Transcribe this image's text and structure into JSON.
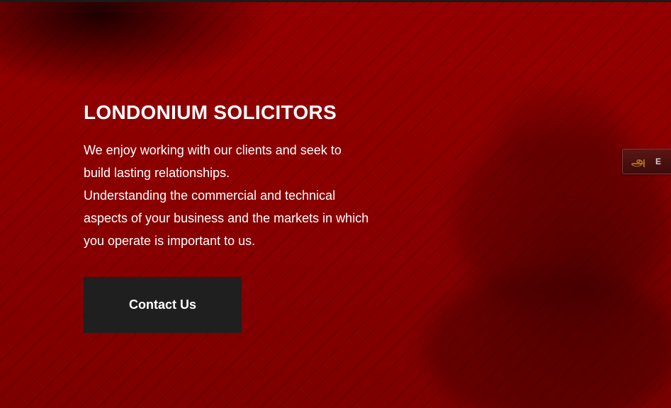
{
  "hero": {
    "title": "LONDONIUM SOLICITORS",
    "description_lines": [
      "We enjoy working with our clients and seek to",
      "build lasting relationships.",
      "Understanding the commercial and technical",
      "aspects of your business and the markets in which",
      "you operate is important to us."
    ],
    "cta_label": "Contact Us"
  },
  "side_widget": {
    "icon": "translate-icon",
    "glyph": "அ",
    "label": "E"
  },
  "colors": {
    "background": "#8a0000",
    "text": "#ffffff",
    "button_bg": "#1f1f1f",
    "widget_glyph": "#b07a1a"
  }
}
